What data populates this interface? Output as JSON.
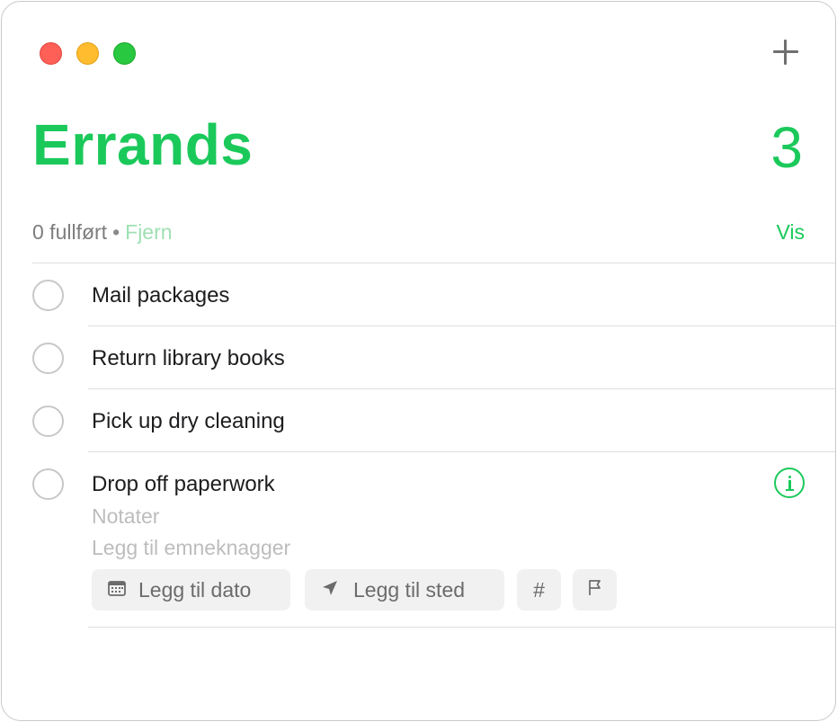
{
  "window": {
    "add_icon": "plus-icon"
  },
  "list": {
    "title": "Errands",
    "count": "3",
    "completed_text": "0 fullført",
    "separator": "•",
    "clear_label": "Fjern",
    "show_label": "Vis",
    "accent_color": "#1bc95b"
  },
  "tasks": [
    {
      "title": "Mail packages"
    },
    {
      "title": "Return library books"
    },
    {
      "title": "Pick up dry cleaning"
    },
    {
      "title": "Drop off paperwork",
      "notes_placeholder": "Notater",
      "tags_placeholder": "Legg til emneknagger"
    }
  ],
  "quick_actions": {
    "add_date": "Legg til dato",
    "add_place": "Legg til sted",
    "tag_glyph": "#",
    "date_icon": "calendar-icon",
    "place_icon": "location-arrow-icon",
    "flag_icon": "flag-icon",
    "info_icon": "info-icon"
  }
}
